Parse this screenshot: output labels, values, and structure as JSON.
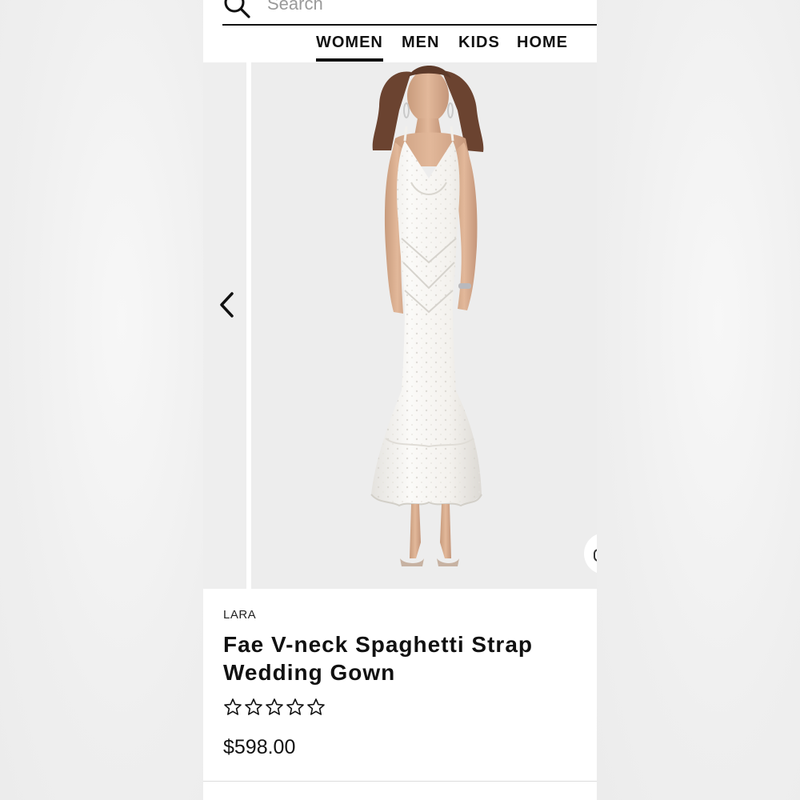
{
  "search": {
    "placeholder": "Search",
    "icon": "search-icon"
  },
  "nav": {
    "tabs": [
      {
        "label": "WOMEN",
        "active": true
      },
      {
        "label": "MEN",
        "active": false
      },
      {
        "label": "KIDS",
        "active": false
      },
      {
        "label": "HOME",
        "active": false
      }
    ]
  },
  "carousel": {
    "prev_icon": "chevron-left-icon",
    "next_icon": "chevron-right-icon",
    "image": "product-photo-white-beaded-gown"
  },
  "product": {
    "brand": "LARA",
    "title": "Fae V-neck Spaghetti Strap Wedding Gown",
    "rating_stars": 5,
    "rating_filled": 0,
    "price": "$598.00"
  },
  "colors": {
    "text": "#111111",
    "accent": "#111111",
    "image_bg": "#ededed"
  }
}
